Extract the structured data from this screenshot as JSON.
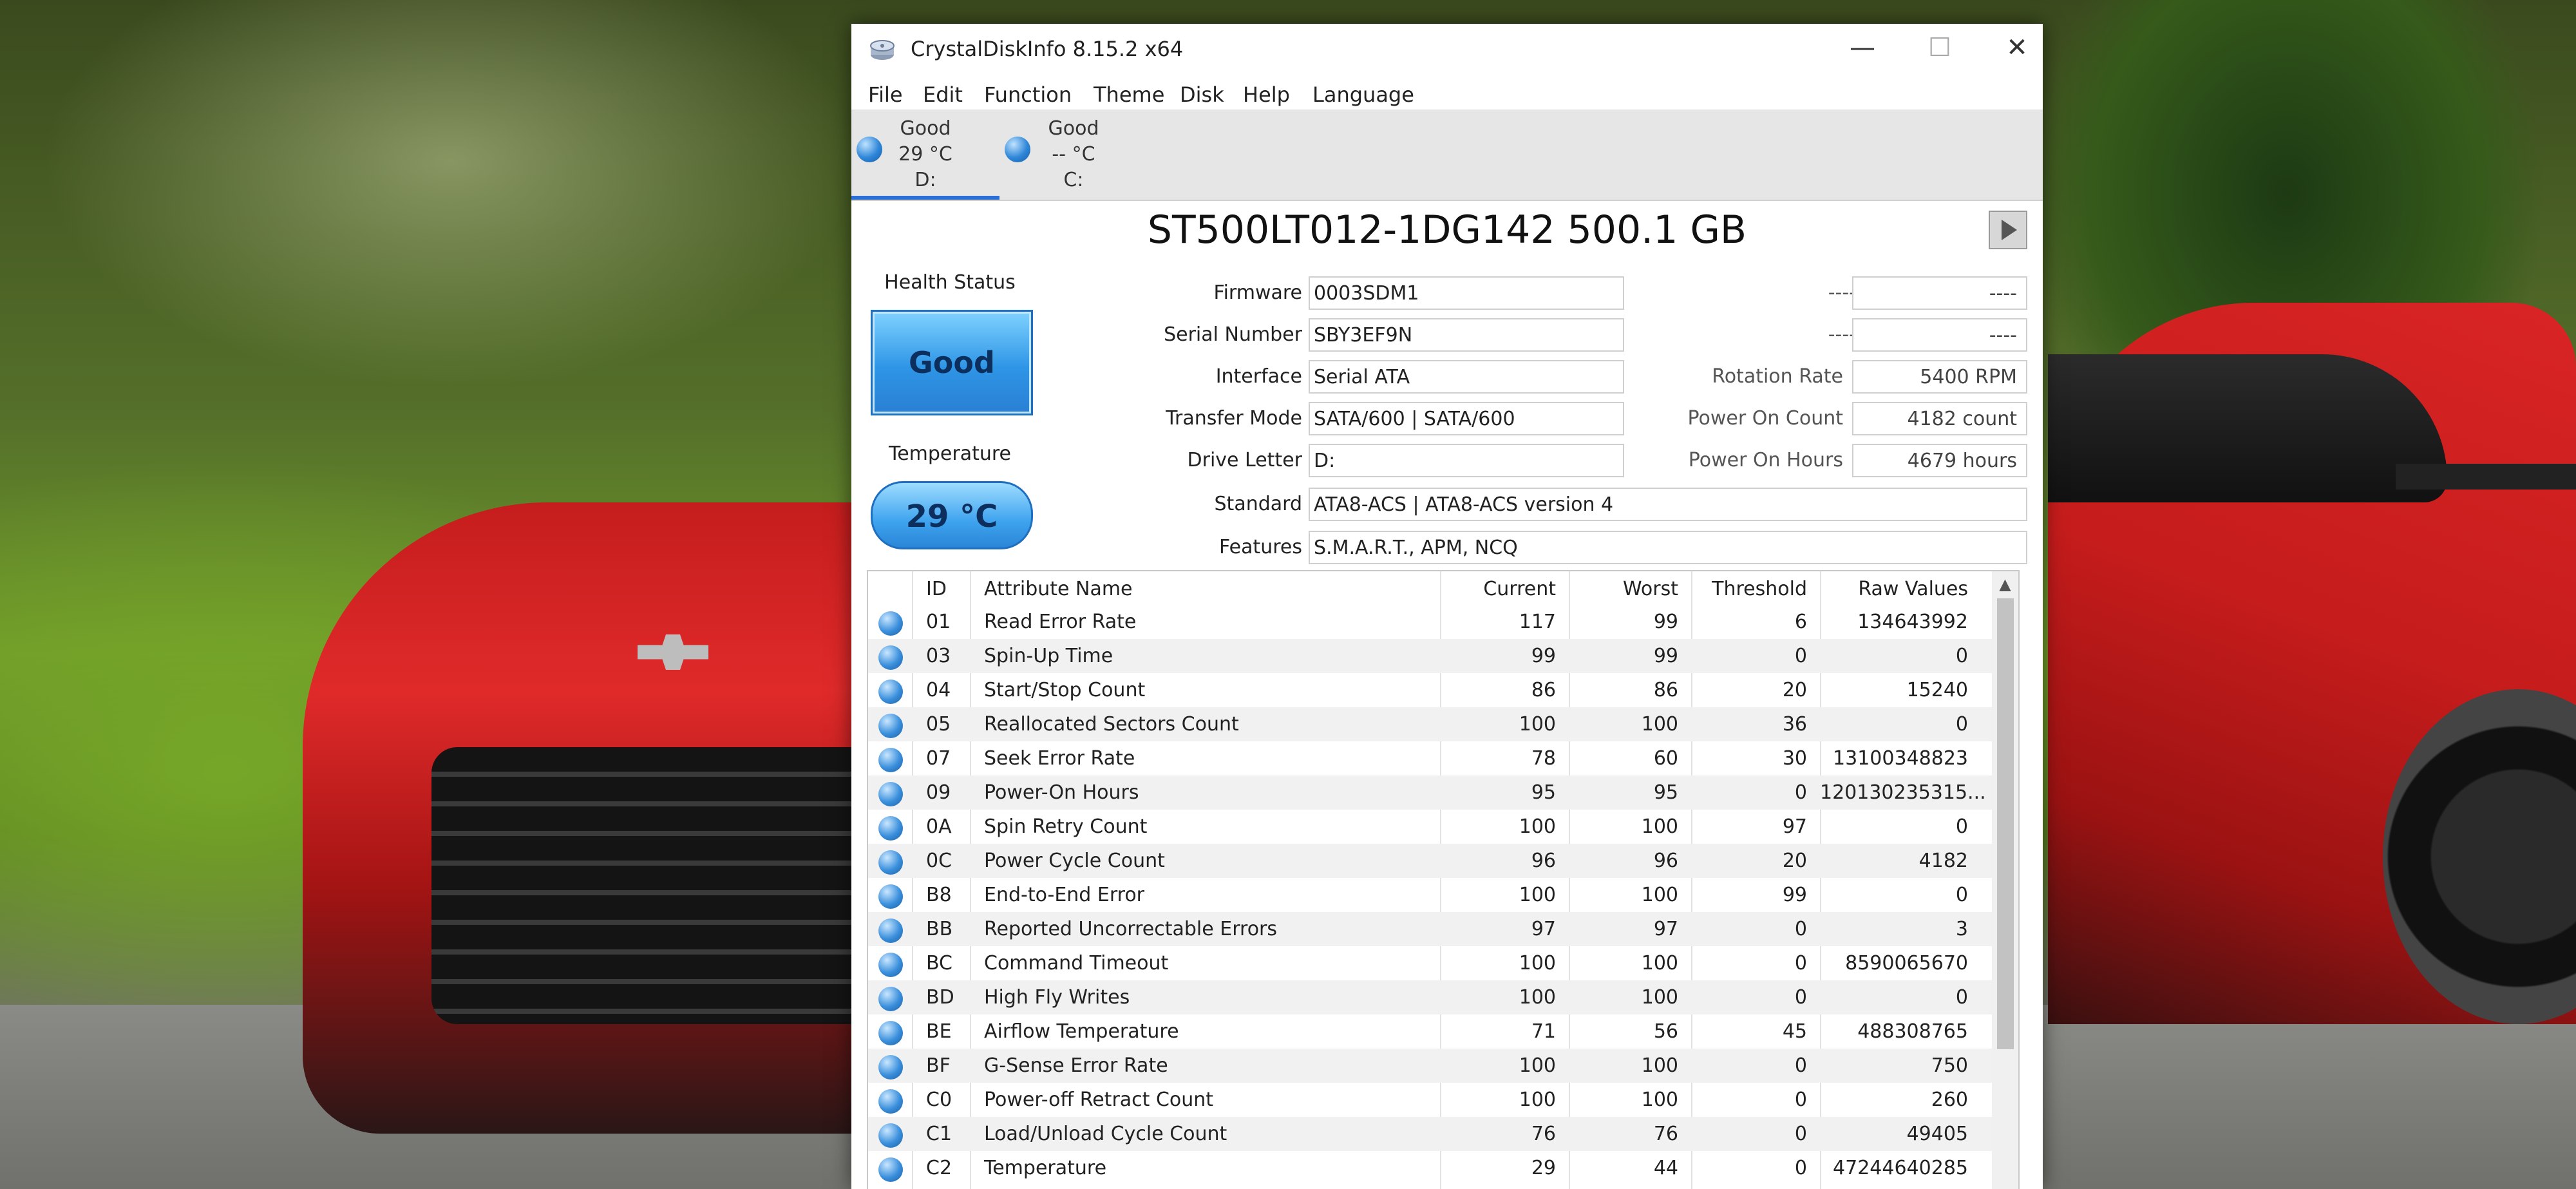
{
  "window": {
    "title": "CrystalDiskInfo 8.15.2 x64",
    "controls": {
      "minimize": "—",
      "maximize": "☐",
      "close": "✕"
    }
  },
  "menu": [
    "File",
    "Edit",
    "Function",
    "Theme",
    "Disk",
    "Help",
    "Language"
  ],
  "disk_tabs": [
    {
      "status": "Good",
      "temp": "29 °C",
      "drive": "D:"
    },
    {
      "status": "Good",
      "temp": "-- °C",
      "drive": "C:"
    }
  ],
  "model": "ST500LT012-1DG142 500.1 GB",
  "health": {
    "label": "Health Status",
    "value": "Good"
  },
  "temperature": {
    "label": "Temperature",
    "value": "29 °C"
  },
  "info": {
    "firmware": {
      "label": "Firmware",
      "value": "0003SDM1"
    },
    "serial": {
      "label": "Serial Number",
      "value": "SBY3EF9N"
    },
    "interface": {
      "label": "Interface",
      "value": "Serial ATA"
    },
    "transfer": {
      "label": "Transfer Mode",
      "value": "SATA/600 | SATA/600"
    },
    "letter": {
      "label": "Drive Letter",
      "value": "D:"
    },
    "standard": {
      "label": "Standard",
      "value": "ATA8-ACS | ATA8-ACS version 4"
    },
    "features": {
      "label": "Features",
      "value": "S.M.A.R.T., APM, NCQ"
    }
  },
  "right_info": {
    "r1": {
      "label": "----",
      "value": "----"
    },
    "r2": {
      "label": "----",
      "value": "----"
    },
    "rotation": {
      "label": "Rotation Rate",
      "value": "5400 RPM"
    },
    "power_count": {
      "label": "Power On Count",
      "value": "4182 count"
    },
    "power_hours": {
      "label": "Power On Hours",
      "value": "4679 hours"
    }
  },
  "smart": {
    "headers": {
      "id": "ID",
      "name": "Attribute Name",
      "current": "Current",
      "worst": "Worst",
      "threshold": "Threshold",
      "raw": "Raw Values"
    },
    "rows": [
      {
        "id": "01",
        "name": "Read Error Rate",
        "current": "117",
        "worst": "99",
        "threshold": "6",
        "raw": "134643992"
      },
      {
        "id": "03",
        "name": "Spin-Up Time",
        "current": "99",
        "worst": "99",
        "threshold": "0",
        "raw": "0"
      },
      {
        "id": "04",
        "name": "Start/Stop Count",
        "current": "86",
        "worst": "86",
        "threshold": "20",
        "raw": "15240"
      },
      {
        "id": "05",
        "name": "Reallocated Sectors Count",
        "current": "100",
        "worst": "100",
        "threshold": "36",
        "raw": "0"
      },
      {
        "id": "07",
        "name": "Seek Error Rate",
        "current": "78",
        "worst": "60",
        "threshold": "30",
        "raw": "13100348823"
      },
      {
        "id": "09",
        "name": "Power-On Hours",
        "current": "95",
        "worst": "95",
        "threshold": "0",
        "raw": "120130235315..."
      },
      {
        "id": "0A",
        "name": "Spin Retry Count",
        "current": "100",
        "worst": "100",
        "threshold": "97",
        "raw": "0"
      },
      {
        "id": "0C",
        "name": "Power Cycle Count",
        "current": "96",
        "worst": "96",
        "threshold": "20",
        "raw": "4182"
      },
      {
        "id": "B8",
        "name": "End-to-End Error",
        "current": "100",
        "worst": "100",
        "threshold": "99",
        "raw": "0"
      },
      {
        "id": "BB",
        "name": "Reported Uncorrectable Errors",
        "current": "97",
        "worst": "97",
        "threshold": "0",
        "raw": "3"
      },
      {
        "id": "BC",
        "name": "Command Timeout",
        "current": "100",
        "worst": "100",
        "threshold": "0",
        "raw": "8590065670"
      },
      {
        "id": "BD",
        "name": "High Fly Writes",
        "current": "100",
        "worst": "100",
        "threshold": "0",
        "raw": "0"
      },
      {
        "id": "BE",
        "name": "Airflow Temperature",
        "current": "71",
        "worst": "56",
        "threshold": "45",
        "raw": "488308765"
      },
      {
        "id": "BF",
        "name": "G-Sense Error Rate",
        "current": "100",
        "worst": "100",
        "threshold": "0",
        "raw": "750"
      },
      {
        "id": "C0",
        "name": "Power-off Retract Count",
        "current": "100",
        "worst": "100",
        "threshold": "0",
        "raw": "260"
      },
      {
        "id": "C1",
        "name": "Load/Unload Cycle Count",
        "current": "76",
        "worst": "76",
        "threshold": "0",
        "raw": "49405"
      },
      {
        "id": "C2",
        "name": "Temperature",
        "current": "29",
        "worst": "44",
        "threshold": "0",
        "raw": "47244640285"
      }
    ]
  },
  "colors": {
    "accent": "#2b6fd6",
    "good_badge": "#2e95e6",
    "status_dot": "#3a8fdc"
  },
  "icons": {
    "app": "crystaldiskinfo-disk-icon",
    "status": "good-status-dot",
    "play": "play-icon"
  }
}
